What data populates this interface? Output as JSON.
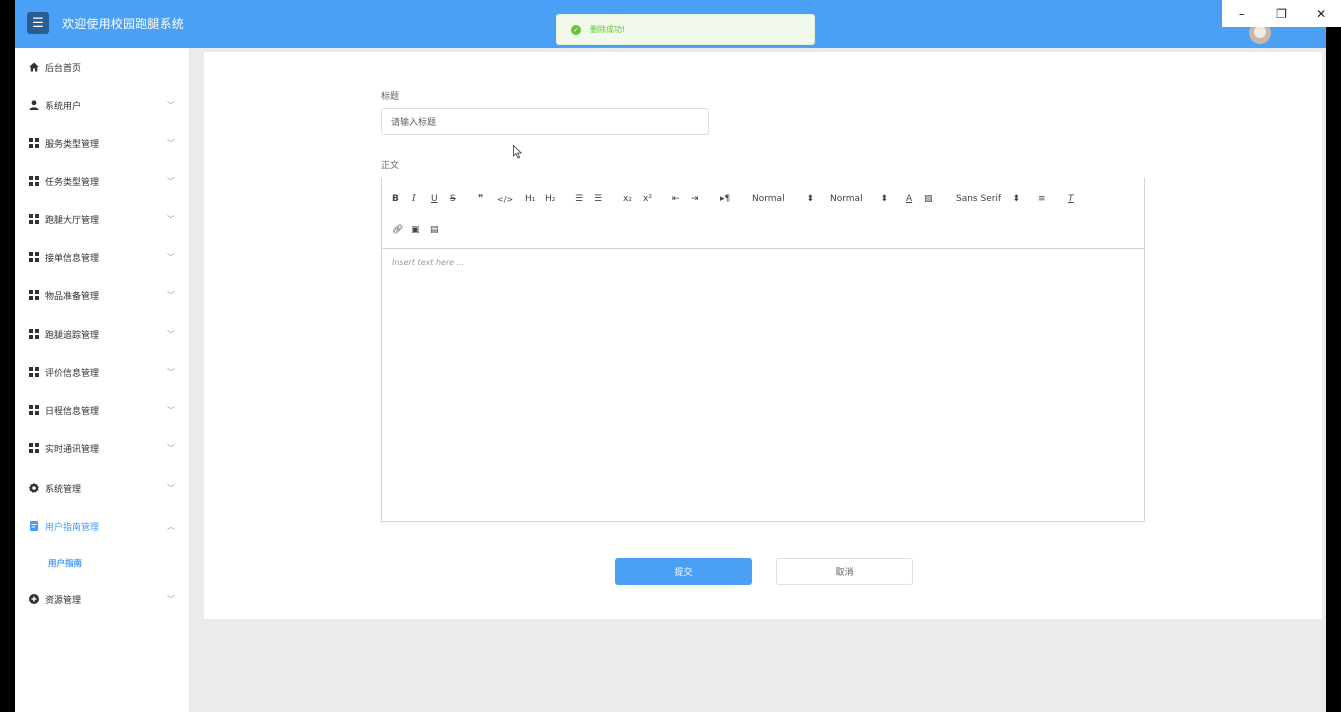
{
  "header": {
    "title": "欢迎使用校园跑腿系统",
    "menu_icon": "menu-icon",
    "accent": "#4aa0f5"
  },
  "window_controls": {
    "minimize": "–",
    "restore": "❐",
    "close": "✕"
  },
  "toast": {
    "message": "删除成功!",
    "color": "#67c23a"
  },
  "sidebar": {
    "items": [
      {
        "label": "后台首页",
        "icon": "home-icon"
      },
      {
        "label": "系统用户",
        "icon": "user-icon"
      },
      {
        "label": "服务类型管理",
        "icon": "grid-icon"
      },
      {
        "label": "任务类型管理",
        "icon": "grid-icon"
      },
      {
        "label": "跑腿大厅管理",
        "icon": "grid-icon"
      },
      {
        "label": "接单信息管理",
        "icon": "grid-icon"
      },
      {
        "label": "物品准备管理",
        "icon": "grid-icon"
      },
      {
        "label": "跑腿追踪管理",
        "icon": "grid-icon"
      },
      {
        "label": "评价信息管理",
        "icon": "grid-icon"
      },
      {
        "label": "日程信息管理",
        "icon": "grid-icon"
      },
      {
        "label": "实时通讯管理",
        "icon": "grid-icon"
      },
      {
        "label": "系统管理",
        "icon": "gear-icon"
      },
      {
        "label": "用户指南管理",
        "icon": "document-icon"
      },
      {
        "label": "资源管理",
        "icon": "plus-circle-icon"
      }
    ],
    "sub_item": "用户指南"
  },
  "form": {
    "title_label": "标题",
    "title_placeholder": "请输入标题",
    "body_label": "正文",
    "editor": {
      "header_select": "Normal",
      "size_select": "Normal",
      "font_select": "Sans Serif",
      "placeholder": "Insert text here ..."
    },
    "submit": "提交",
    "cancel": "取消"
  }
}
